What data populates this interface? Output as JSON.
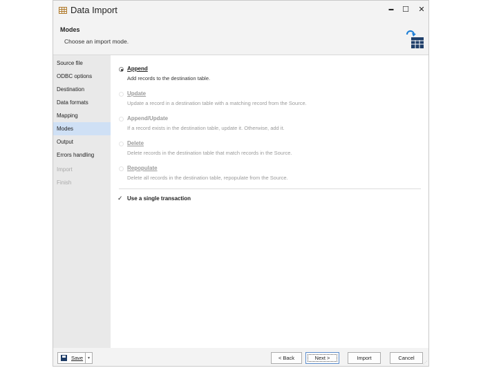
{
  "window": {
    "title": "Data Import"
  },
  "header": {
    "title": "Modes",
    "subtitle": "Choose an import mode."
  },
  "sidebar": {
    "items": [
      {
        "label": "Source file",
        "state": "normal"
      },
      {
        "label": "ODBC options",
        "state": "normal"
      },
      {
        "label": "Destination",
        "state": "normal"
      },
      {
        "label": "Data formats",
        "state": "normal"
      },
      {
        "label": "Mapping",
        "state": "normal"
      },
      {
        "label": "Modes",
        "state": "active"
      },
      {
        "label": "Output",
        "state": "normal"
      },
      {
        "label": "Errors handling",
        "state": "normal"
      },
      {
        "label": "Import",
        "state": "disabled"
      },
      {
        "label": "Finish",
        "state": "disabled"
      }
    ]
  },
  "modes": [
    {
      "label": "Append",
      "description": "Add records to the destination table.",
      "selected": true,
      "enabled": true
    },
    {
      "label": "Update",
      "description": "Update a record in a destination table with a matching record from the Source.",
      "selected": false,
      "enabled": false
    },
    {
      "label": "Append/Update",
      "description": "If a record exists in the destination table, update it. Otherwise, add it.",
      "selected": false,
      "enabled": false
    },
    {
      "label": "Delete",
      "description": "Delete records in the destination table that match records in the Source.",
      "selected": false,
      "enabled": false
    },
    {
      "label": "Repopulate",
      "description": "Delete all records in the destination table, repopulate from the Source.",
      "selected": false,
      "enabled": false
    }
  ],
  "transaction": {
    "label": "Use a single transaction",
    "checked": true,
    "mark": "✓"
  },
  "footer": {
    "save_label": "Save",
    "back_label": "< Back",
    "next_label": "Next >",
    "import_label": "Import",
    "cancel_label": "Cancel"
  },
  "icons": {
    "minimize": "▬",
    "maximize": "☐",
    "close": "✕",
    "dropdown": "▾",
    "grip": "⋰"
  },
  "colors": {
    "active_nav": "#cfe0f5",
    "header_icon": "#1f3f6a",
    "arrow_blue": "#1e7fd6"
  }
}
